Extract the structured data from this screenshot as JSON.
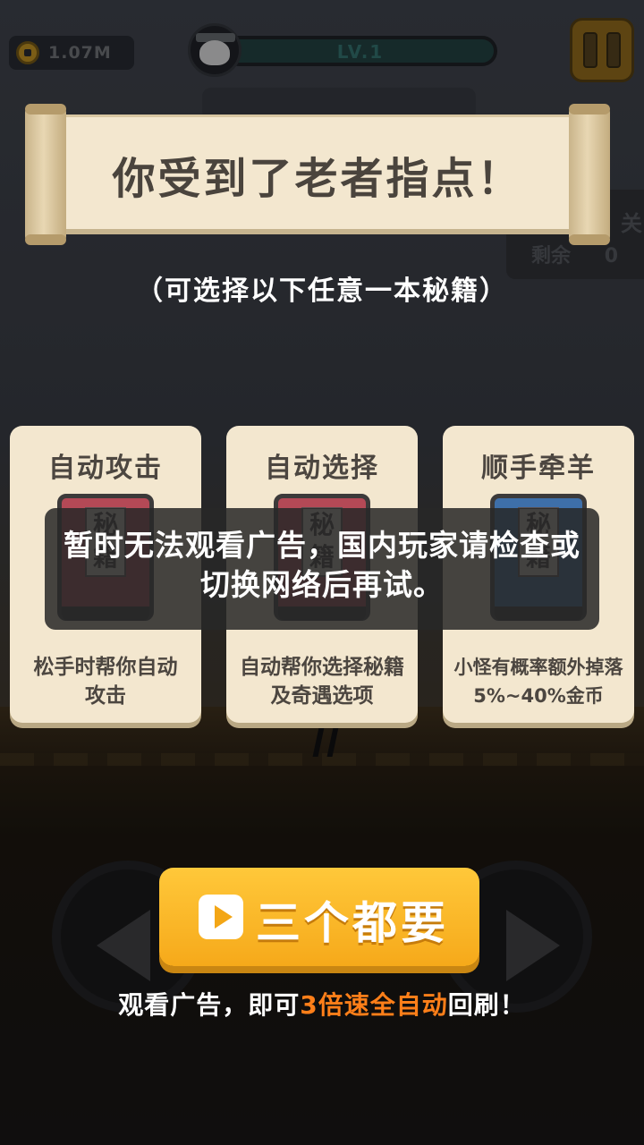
{
  "hud": {
    "coins": "1.07M",
    "level": "LV.1",
    "side_stage_suffix": "关",
    "side_remaining_label": "剩余",
    "side_remaining_value": "0"
  },
  "banner": {
    "title": "你受到了老者指点！",
    "subtitle": "（可选择以下任意一本秘籍）"
  },
  "cards": [
    {
      "title": "自动攻击",
      "book_char": "秘\n籍",
      "book_color": "#b44956",
      "description": "松手时帮你自动攻击"
    },
    {
      "title": "自动选择",
      "book_char": "秘\n籍",
      "book_color": "#b44956",
      "description": "自动帮你选择秘籍及奇遇选项"
    },
    {
      "title": "顺手牵羊",
      "book_char": "秘\n籍",
      "book_color": "#3e6fa9",
      "description": "小怪有概率额外掉落5%~40%金币"
    }
  ],
  "toast": {
    "message": "暂时无法观看广告，国内玩家请检查或切换网络后再试。"
  },
  "main_button": {
    "label": "三个都要",
    "icon": "play-icon"
  },
  "hint": {
    "prefix": "观看广告，即可",
    "highlight": "3倍速全自动",
    "suffix": "回刷！",
    "highlight_color": "#ff7f19"
  }
}
